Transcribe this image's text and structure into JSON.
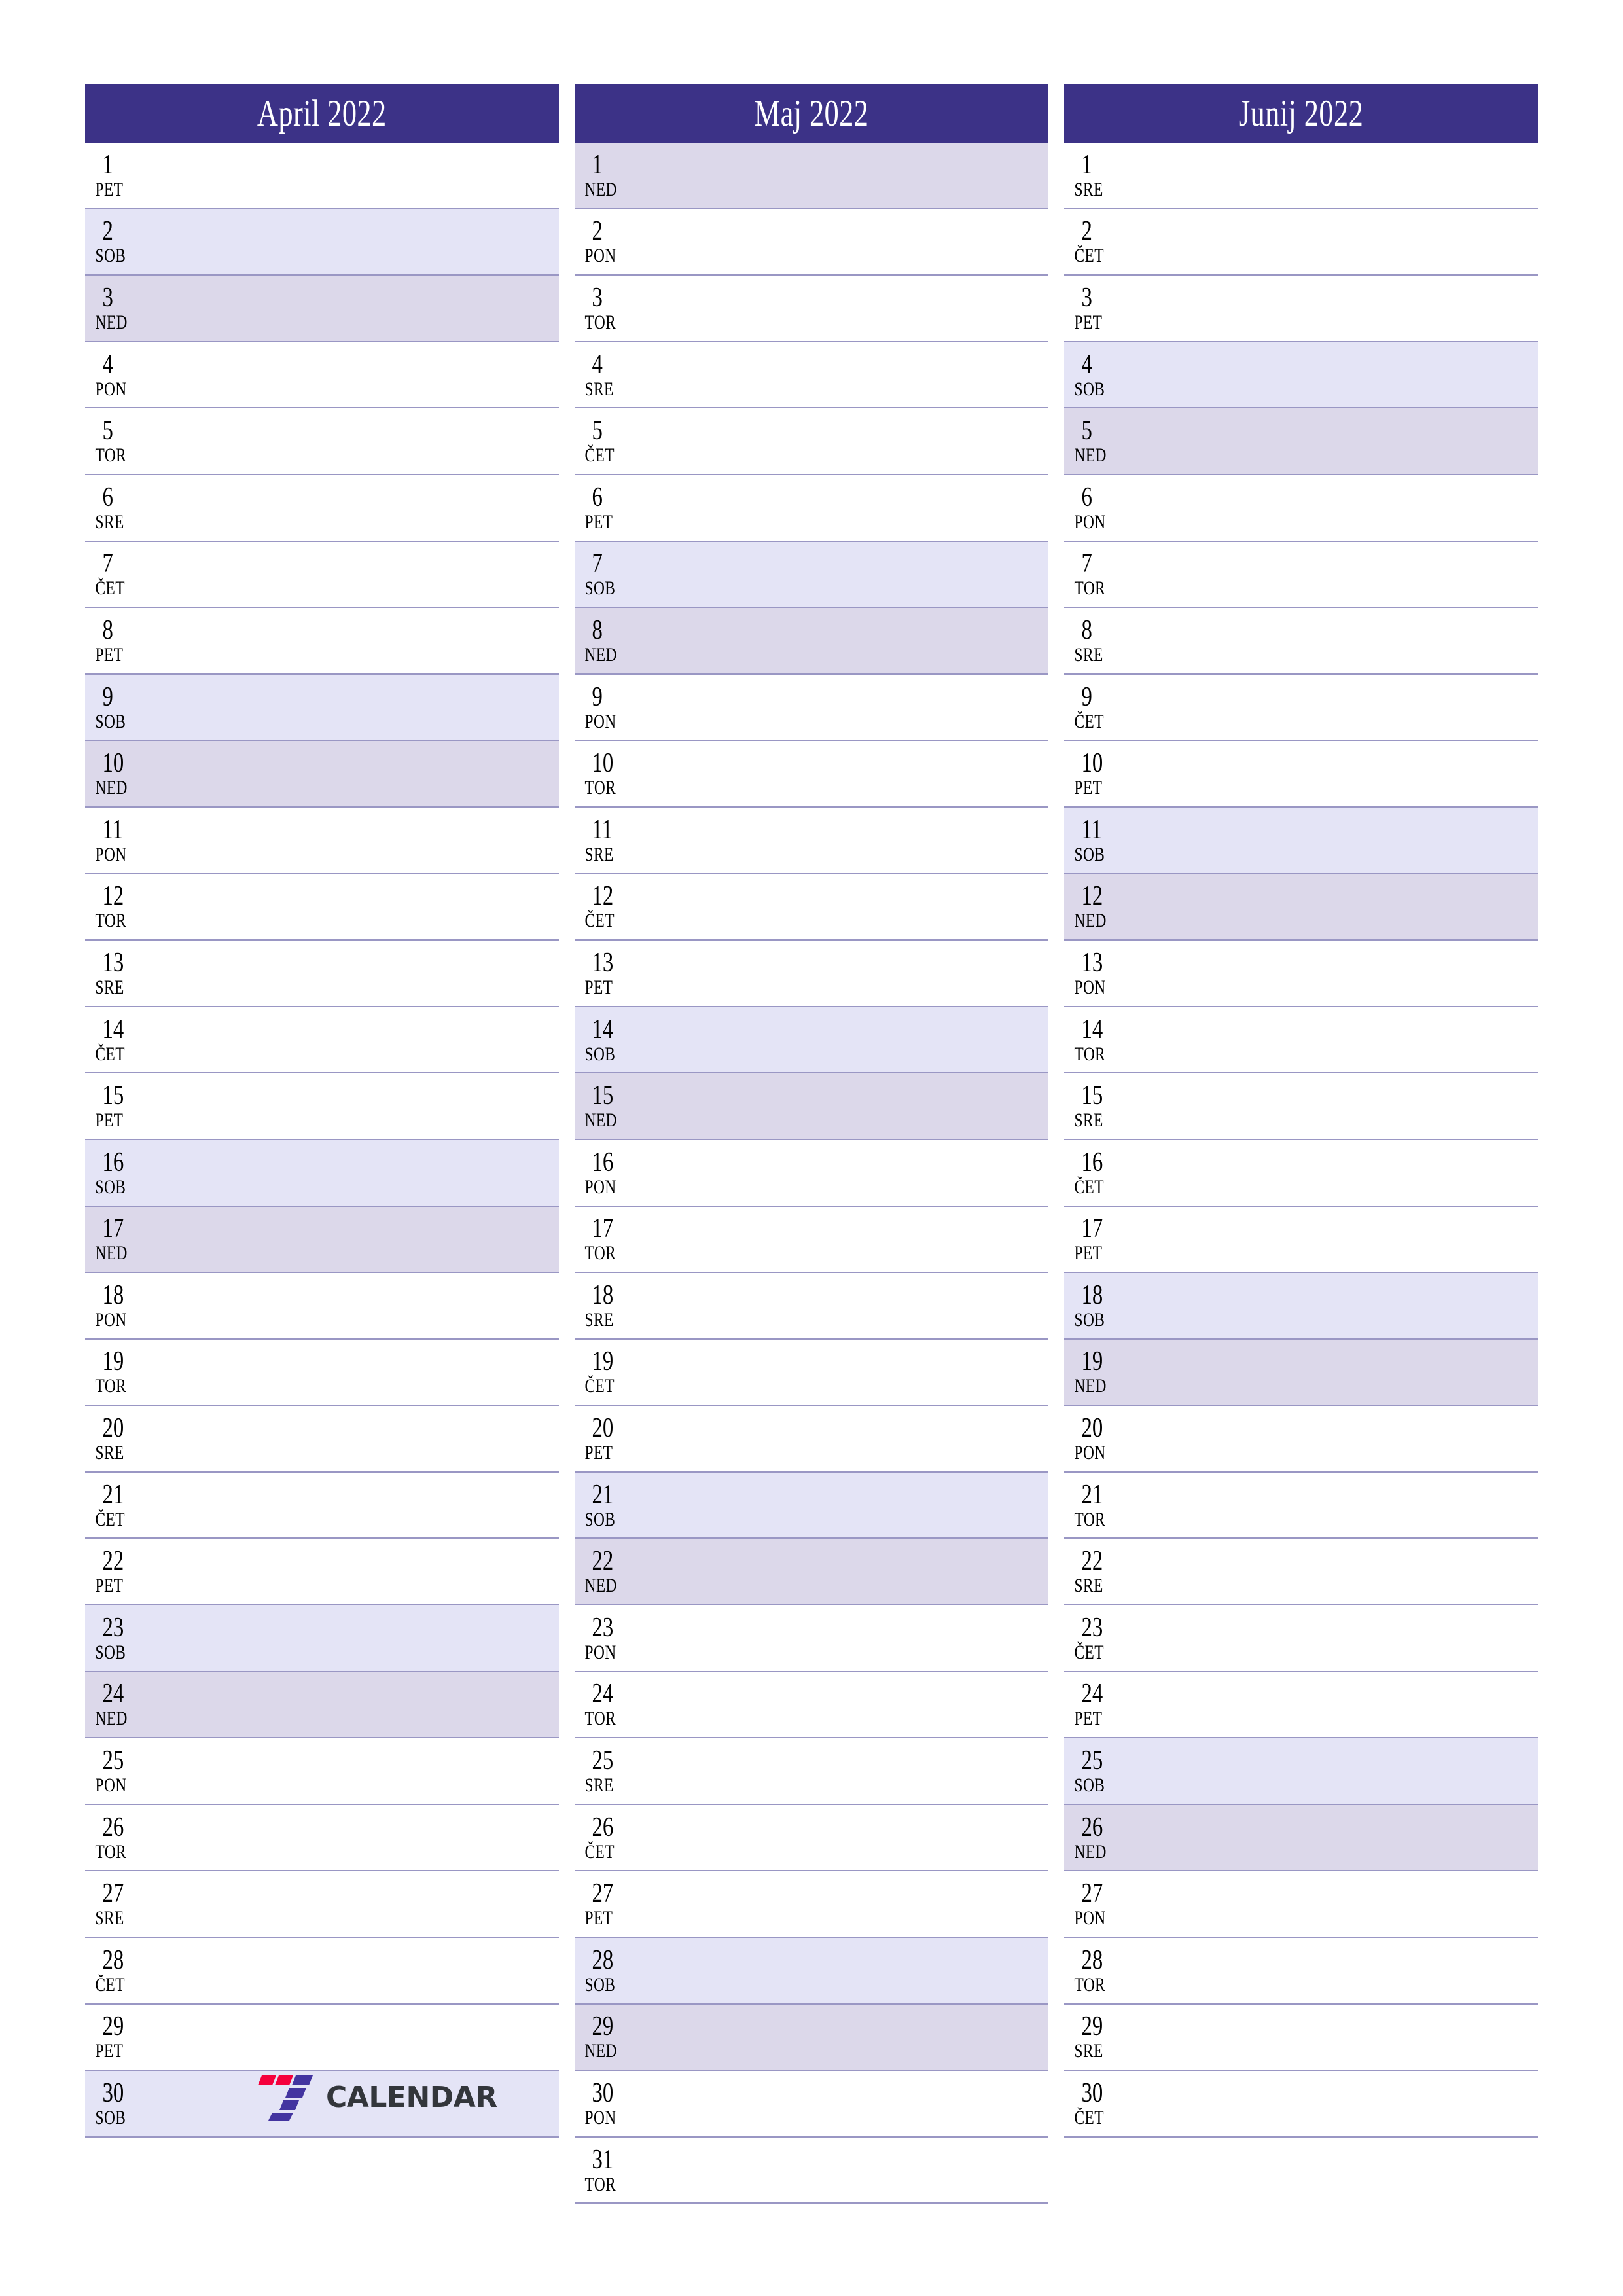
{
  "page": {
    "type": "quarterly-planner",
    "year": "2022",
    "locale": "sl"
  },
  "logo": {
    "word": "CALENDAR",
    "mark_name": "seven-logo-icon",
    "red": "#f5003c",
    "blue": "#4334a0",
    "text_color": "#33363b"
  },
  "colors": {
    "header_bg": "#3c3287",
    "header_text": "#ffffff",
    "saturday_bg": "#e4e4f6",
    "sunday_bg": "#dcd8ea",
    "row_line": "#9a97c4",
    "day_text": "#000000"
  },
  "months": [
    {
      "title": "April 2022",
      "name": "April",
      "days": [
        {
          "num": "1",
          "abbr": "PET"
        },
        {
          "num": "2",
          "abbr": "SOB"
        },
        {
          "num": "3",
          "abbr": "NED"
        },
        {
          "num": "4",
          "abbr": "PON"
        },
        {
          "num": "5",
          "abbr": "TOR"
        },
        {
          "num": "6",
          "abbr": "SRE"
        },
        {
          "num": "7",
          "abbr": "ČET"
        },
        {
          "num": "8",
          "abbr": "PET"
        },
        {
          "num": "9",
          "abbr": "SOB"
        },
        {
          "num": "10",
          "abbr": "NED"
        },
        {
          "num": "11",
          "abbr": "PON"
        },
        {
          "num": "12",
          "abbr": "TOR"
        },
        {
          "num": "13",
          "abbr": "SRE"
        },
        {
          "num": "14",
          "abbr": "ČET"
        },
        {
          "num": "15",
          "abbr": "PET"
        },
        {
          "num": "16",
          "abbr": "SOB"
        },
        {
          "num": "17",
          "abbr": "NED"
        },
        {
          "num": "18",
          "abbr": "PON"
        },
        {
          "num": "19",
          "abbr": "TOR"
        },
        {
          "num": "20",
          "abbr": "SRE"
        },
        {
          "num": "21",
          "abbr": "ČET"
        },
        {
          "num": "22",
          "abbr": "PET"
        },
        {
          "num": "23",
          "abbr": "SOB"
        },
        {
          "num": "24",
          "abbr": "NED"
        },
        {
          "num": "25",
          "abbr": "PON"
        },
        {
          "num": "26",
          "abbr": "TOR"
        },
        {
          "num": "27",
          "abbr": "SRE"
        },
        {
          "num": "28",
          "abbr": "ČET"
        },
        {
          "num": "29",
          "abbr": "PET"
        },
        {
          "num": "30",
          "abbr": "SOB"
        }
      ]
    },
    {
      "title": "Maj 2022",
      "name": "Maj",
      "days": [
        {
          "num": "1",
          "abbr": "NED"
        },
        {
          "num": "2",
          "abbr": "PON"
        },
        {
          "num": "3",
          "abbr": "TOR"
        },
        {
          "num": "4",
          "abbr": "SRE"
        },
        {
          "num": "5",
          "abbr": "ČET"
        },
        {
          "num": "6",
          "abbr": "PET"
        },
        {
          "num": "7",
          "abbr": "SOB"
        },
        {
          "num": "8",
          "abbr": "NED"
        },
        {
          "num": "9",
          "abbr": "PON"
        },
        {
          "num": "10",
          "abbr": "TOR"
        },
        {
          "num": "11",
          "abbr": "SRE"
        },
        {
          "num": "12",
          "abbr": "ČET"
        },
        {
          "num": "13",
          "abbr": "PET"
        },
        {
          "num": "14",
          "abbr": "SOB"
        },
        {
          "num": "15",
          "abbr": "NED"
        },
        {
          "num": "16",
          "abbr": "PON"
        },
        {
          "num": "17",
          "abbr": "TOR"
        },
        {
          "num": "18",
          "abbr": "SRE"
        },
        {
          "num": "19",
          "abbr": "ČET"
        },
        {
          "num": "20",
          "abbr": "PET"
        },
        {
          "num": "21",
          "abbr": "SOB"
        },
        {
          "num": "22",
          "abbr": "NED"
        },
        {
          "num": "23",
          "abbr": "PON"
        },
        {
          "num": "24",
          "abbr": "TOR"
        },
        {
          "num": "25",
          "abbr": "SRE"
        },
        {
          "num": "26",
          "abbr": "ČET"
        },
        {
          "num": "27",
          "abbr": "PET"
        },
        {
          "num": "28",
          "abbr": "SOB"
        },
        {
          "num": "29",
          "abbr": "NED"
        },
        {
          "num": "30",
          "abbr": "PON"
        },
        {
          "num": "31",
          "abbr": "TOR"
        }
      ]
    },
    {
      "title": "Junij 2022",
      "name": "Junij",
      "days": [
        {
          "num": "1",
          "abbr": "SRE"
        },
        {
          "num": "2",
          "abbr": "ČET"
        },
        {
          "num": "3",
          "abbr": "PET"
        },
        {
          "num": "4",
          "abbr": "SOB"
        },
        {
          "num": "5",
          "abbr": "NED"
        },
        {
          "num": "6",
          "abbr": "PON"
        },
        {
          "num": "7",
          "abbr": "TOR"
        },
        {
          "num": "8",
          "abbr": "SRE"
        },
        {
          "num": "9",
          "abbr": "ČET"
        },
        {
          "num": "10",
          "abbr": "PET"
        },
        {
          "num": "11",
          "abbr": "SOB"
        },
        {
          "num": "12",
          "abbr": "NED"
        },
        {
          "num": "13",
          "abbr": "PON"
        },
        {
          "num": "14",
          "abbr": "TOR"
        },
        {
          "num": "15",
          "abbr": "SRE"
        },
        {
          "num": "16",
          "abbr": "ČET"
        },
        {
          "num": "17",
          "abbr": "PET"
        },
        {
          "num": "18",
          "abbr": "SOB"
        },
        {
          "num": "19",
          "abbr": "NED"
        },
        {
          "num": "20",
          "abbr": "PON"
        },
        {
          "num": "21",
          "abbr": "TOR"
        },
        {
          "num": "22",
          "abbr": "SRE"
        },
        {
          "num": "23",
          "abbr": "ČET"
        },
        {
          "num": "24",
          "abbr": "PET"
        },
        {
          "num": "25",
          "abbr": "SOB"
        },
        {
          "num": "26",
          "abbr": "NED"
        },
        {
          "num": "27",
          "abbr": "PON"
        },
        {
          "num": "28",
          "abbr": "TOR"
        },
        {
          "num": "29",
          "abbr": "SRE"
        },
        {
          "num": "30",
          "abbr": "ČET"
        }
      ]
    }
  ]
}
